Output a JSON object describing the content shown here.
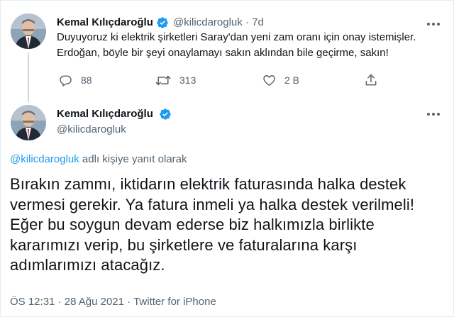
{
  "colors": {
    "text": "#0f1419",
    "secondary": "#536471",
    "accent": "#1d9bf0",
    "verified": "#1d9bf0",
    "border": "#e6ecf0"
  },
  "parent_tweet": {
    "avatar_icon": "profile-photo",
    "name": "Kemal Kılıçdaroğlu",
    "verified_icon": "verified-badge-icon",
    "handle": "@kilicdarogluk",
    "separator": "·",
    "time": "7d",
    "more_icon": "more-icon",
    "text_line1": "Duyuyoruz ki elektrik şirketleri Saray'dan yeni zam oranı için onay istemişler.",
    "text_line2": "Erdoğan, böyle bir şeyi onaylamayı sakın aklından bile geçirme, sakın!",
    "actions": {
      "reply_icon": "reply-icon",
      "reply_count": "88",
      "retweet_icon": "retweet-icon",
      "retweet_count": "313",
      "like_icon": "heart-icon",
      "like_count": "2 B",
      "share_icon": "share-icon"
    }
  },
  "main_tweet": {
    "avatar_icon": "profile-photo",
    "name": "Kemal Kılıçdaroğlu",
    "verified_icon": "verified-badge-icon",
    "handle": "@kilicdarogluk",
    "more_icon": "more-icon",
    "reply_to_mention": "@kilicdarogluk",
    "reply_to_suffix": " adlı kişiye yanıt olarak",
    "text": "Bırakın zammı, iktidarın elektrik faturasında halka destek vermesi gerekir. Ya fatura inmeli ya halka destek verilmeli! Eğer bu soygun devam ederse biz halkımızla birlikte kararımızı verip, bu şirketlere ve faturalarına karşı adımlarımızı atacağız.",
    "time": "ÖS 12:31",
    "separator1": " · ",
    "date": "28 Ağu 2021",
    "separator2": " · ",
    "source": "Twitter for iPhone"
  }
}
